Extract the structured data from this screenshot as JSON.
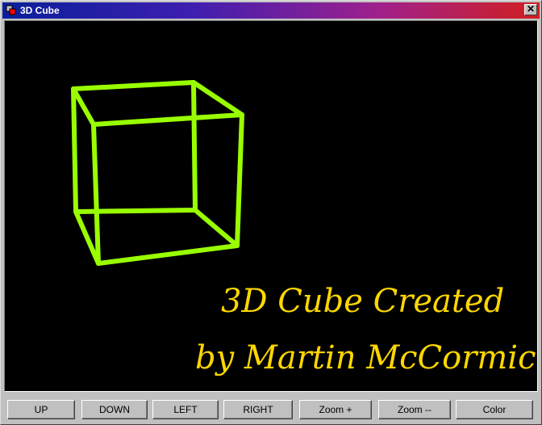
{
  "window": {
    "title": "3D Cube"
  },
  "canvas": {
    "background": "#000000",
    "cube_color": "#99ff00",
    "text_color": "#ffd700",
    "credit_line_1": "3D Cube Created",
    "credit_line_2": "by Martin McCormick"
  },
  "toolbar": {
    "buttons": [
      {
        "label": "UP"
      },
      {
        "label": "DOWN"
      },
      {
        "label": "LEFT"
      },
      {
        "label": "RIGHT"
      },
      {
        "label": "Zoom +"
      },
      {
        "label": "Zoom --"
      },
      {
        "label": "Color"
      }
    ]
  }
}
